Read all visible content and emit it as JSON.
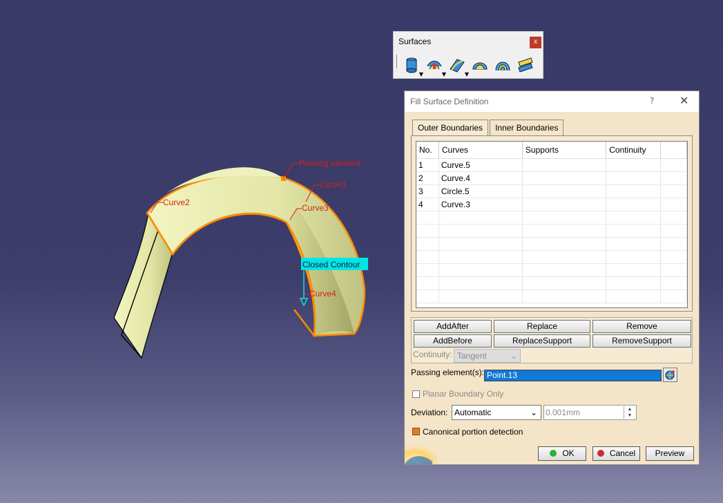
{
  "toolbar": {
    "title": "Surfaces",
    "close_label": "x",
    "icons": [
      "extrude-surface-icon",
      "offset-surface-icon",
      "sweep-surface-icon",
      "fill-surface-icon",
      "multi-section-surface-icon",
      "blend-surface-icon"
    ]
  },
  "viewport": {
    "labels": {
      "passing_element": "Passing element",
      "curve1": "Curve1",
      "curve2": "Curve2",
      "curve3": "Curve3",
      "curve4": "Curve4",
      "closed_contour": "Closed Contour"
    },
    "colors": {
      "surface": "#e6eaa8",
      "boundary": "#ff8a00",
      "label": "#d22020",
      "highlight": "#00e6e6"
    }
  },
  "dialog": {
    "title": "Fill Surface Definition",
    "help": "?",
    "close": "✕",
    "tabs": [
      "Outer Boundaries",
      "Inner Boundaries"
    ],
    "columns": [
      "No.",
      "Curves",
      "Supports",
      "Continuity"
    ],
    "rows": [
      {
        "no": "1",
        "curve": "Curve.5",
        "support": "",
        "continuity": ""
      },
      {
        "no": "2",
        "curve": "Curve.4",
        "support": "",
        "continuity": ""
      },
      {
        "no": "3",
        "curve": "Circle.5",
        "support": "",
        "continuity": ""
      },
      {
        "no": "4",
        "curve": "Curve.3",
        "support": "",
        "continuity": ""
      }
    ],
    "buttons": {
      "add_after": "AddAfter",
      "replace": "Replace",
      "remove": "Remove",
      "add_before": "AddBefore",
      "replace_support": "ReplaceSupport",
      "remove_support": "RemoveSupport"
    },
    "continuity_label": "Continuity:",
    "continuity_value": "Tangent",
    "passing_label": "Passing element(s):",
    "passing_value": "Point.13",
    "planar_label": "Planar Boundary Only",
    "deviation_label": "Deviation:",
    "deviation_value": "Automatic",
    "tolerance_value": "0.001mm",
    "canonical_label": "Canonical portion detection",
    "ok": "OK",
    "cancel": "Cancel",
    "preview": "Preview"
  }
}
